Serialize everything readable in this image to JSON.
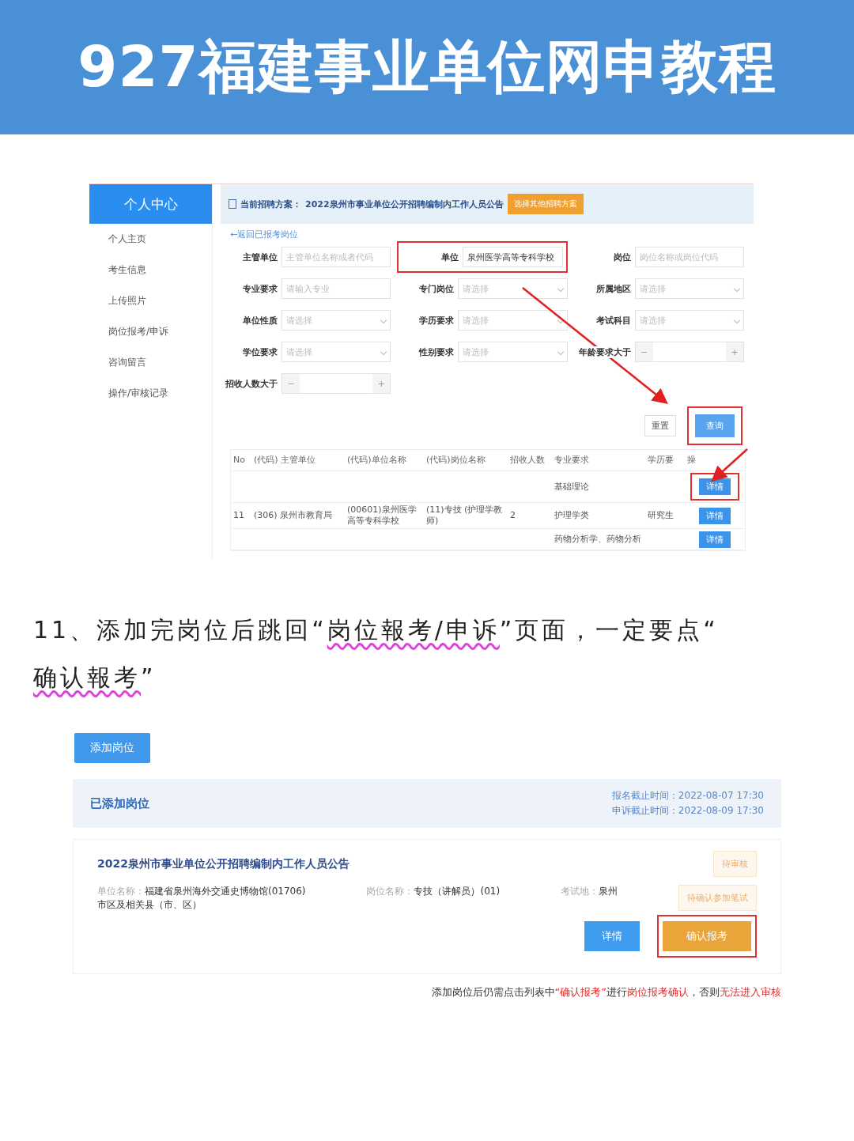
{
  "banner": {
    "title": "927福建事业单位网申教程"
  },
  "screen_1": {
    "sidebar": {
      "title": "个人中心",
      "items": [
        {
          "label": "个人主页",
          "selected": false
        },
        {
          "label": "考生信息",
          "selected": false
        },
        {
          "label": "上传照片",
          "selected": false
        },
        {
          "label": "岗位报考/申诉",
          "selected": false
        },
        {
          "label": "咨询留言",
          "selected": false
        },
        {
          "label": "操作/审核记录",
          "selected": false
        }
      ]
    },
    "notice": {
      "label": "当前招聘方案：",
      "text": "2022泉州市事业单位公开招聘编制内工作人员公告",
      "button": "选择其他招聘方案"
    },
    "back_link": "←返回已报考岗位",
    "filters": [
      {
        "kind": "text",
        "label": "主管单位",
        "placeholder": "主管单位名称或者代码",
        "highlighted": false
      },
      {
        "kind": "text",
        "label": "单位",
        "value": "泉州医学高等专科学校",
        "highlighted": true
      },
      {
        "kind": "text",
        "label": "岗位",
        "placeholder": "岗位名称或岗位代码",
        "highlighted": false
      },
      {
        "kind": "text",
        "label": "专业要求",
        "placeholder": "请输入专业",
        "highlighted": false
      },
      {
        "kind": "select",
        "label": "专门岗位",
        "placeholder": "请选择",
        "highlighted": false
      },
      {
        "kind": "select",
        "label": "所属地区",
        "placeholder": "请选择",
        "highlighted": false
      },
      {
        "kind": "select",
        "label": "单位性质",
        "placeholder": "请选择",
        "highlighted": false
      },
      {
        "kind": "select",
        "label": "学历要求",
        "placeholder": "请选择",
        "highlighted": false
      },
      {
        "kind": "select",
        "label": "考试科目",
        "placeholder": "请选择",
        "highlighted": false
      },
      {
        "kind": "select",
        "label": "学位要求",
        "placeholder": "请选择",
        "highlighted": false
      },
      {
        "kind": "select",
        "label": "性别要求",
        "placeholder": "请选择",
        "highlighted": false
      },
      {
        "kind": "stepper",
        "label": "年龄要求大于",
        "minus": "−",
        "plus": "+",
        "highlighted": false
      },
      {
        "kind": "stepper",
        "label": "招收人数大于",
        "minus": "−",
        "plus": "+",
        "highlighted": false
      }
    ],
    "buttons": [
      {
        "kind": "plain",
        "label": "重置",
        "highlighted": false
      },
      {
        "kind": "primary",
        "label": "查询",
        "highlighted": true
      }
    ],
    "table": {
      "columns": [
        "No",
        "(代码) 主管单位",
        "(代码)单位名称",
        "(代码)岗位名称",
        "招收人数",
        "专业要求",
        "学历要",
        "操"
      ],
      "rows": [
        {
          "cells": [
            "",
            "",
            "",
            "",
            "",
            "基础理论",
            ""
          ],
          "action": "详情",
          "highlighted": true
        },
        {
          "cells": [
            "11",
            "(306) 泉州市教育局",
            "(00601)泉州医学高等专科学校",
            "(11)专技 (护理学教师)",
            "2",
            "护理学类",
            "研究生"
          ],
          "action": "详情",
          "highlighted": false
        },
        {
          "cells": [
            "",
            "",
            "",
            "",
            "",
            "药物分析学、药物分析",
            ""
          ],
          "action": "详情",
          "highlighted": false
        }
      ]
    }
  },
  "caption": [
    {
      "text": "11、添加完岗位后跳回“",
      "marked": false
    },
    {
      "text": "岗位報考/申诉",
      "marked": true
    },
    {
      "text": "”页面，一定要点“",
      "marked": false
    },
    {
      "text": "确认報考",
      "marked": true
    },
    {
      "text": "”",
      "marked": false
    }
  ],
  "screen_2": {
    "add_button": "添加岗位",
    "header": {
      "title": "已添加岗位",
      "deadlines": [
        "报名截止时间：2022-08-07 17:30",
        "申诉截止时间：2022-08-09 17:30"
      ]
    },
    "card": {
      "title": "2022泉州市事业单位公开招聘编制内工作人员公告",
      "fields": [
        {
          "label": "单位名称：",
          "value": "福建省泉州海外交通史博物馆(01706)",
          "extra": "市区及相关县（市、区）"
        },
        {
          "label": "岗位名称：",
          "value": "专技（讲解员）(01)"
        },
        {
          "label": "考试地：",
          "value": "泉州"
        }
      ],
      "badges": [
        "待审核",
        "待确认参加笔试"
      ],
      "buttons": [
        {
          "kind": "primary",
          "label": "详情",
          "highlighted": false
        },
        {
          "kind": "warning",
          "label": "确认报考",
          "highlighted": true
        }
      ]
    },
    "note": [
      {
        "text": "添加岗位后仍需点击列表中",
        "emphasis": false
      },
      {
        "text": "“确认报考”",
        "emphasis": true
      },
      {
        "text": "进行",
        "emphasis": false
      },
      {
        "text": "岗位报考确认",
        "emphasis": true
      },
      {
        "text": "，否则",
        "emphasis": false
      },
      {
        "text": "无法进入审核",
        "emphasis": true
      }
    ]
  }
}
